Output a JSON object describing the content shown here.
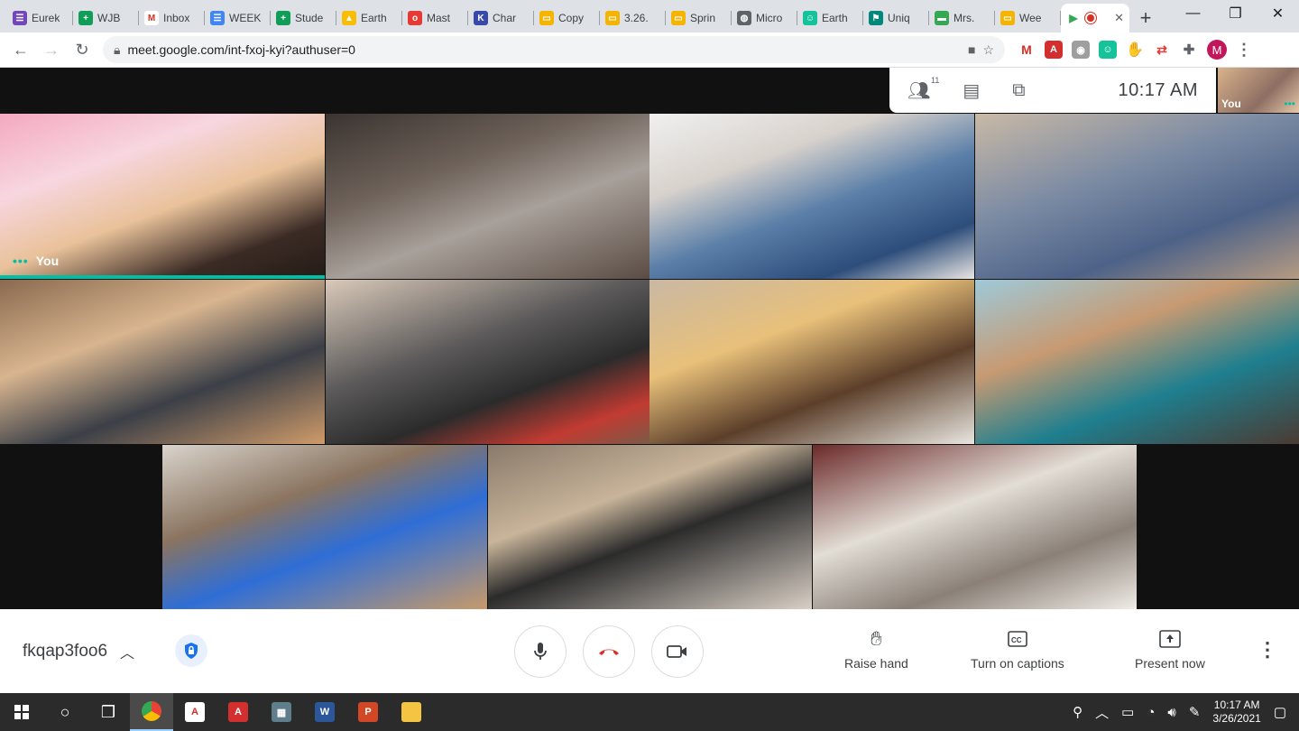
{
  "browser": {
    "tabs": [
      {
        "title": "Eurek",
        "icon": "forms-icon",
        "color": "#7248b9",
        "glyph": "☰"
      },
      {
        "title": "WJB",
        "icon": "sheets-icon",
        "color": "#0f9d58",
        "glyph": "+"
      },
      {
        "title": "Inbox",
        "icon": "gmail-icon",
        "color": "#ffffff",
        "glyph": "M"
      },
      {
        "title": "WEEK",
        "icon": "docs-icon",
        "color": "#4285f4",
        "glyph": "☰"
      },
      {
        "title": "Stude",
        "icon": "sheets-icon",
        "color": "#0f9d58",
        "glyph": "+"
      },
      {
        "title": "Earth",
        "icon": "drive-icon",
        "color": "#fbbc04",
        "glyph": "▲"
      },
      {
        "title": "Mast",
        "icon": "mastery-icon",
        "color": "#e53935",
        "glyph": "o"
      },
      {
        "title": "Char",
        "icon": "k-icon",
        "color": "#3949ab",
        "glyph": "K"
      },
      {
        "title": "Copy",
        "icon": "slides-icon",
        "color": "#f4b400",
        "glyph": "▭"
      },
      {
        "title": "3.26.",
        "icon": "slides-icon",
        "color": "#f4b400",
        "glyph": "▭"
      },
      {
        "title": "Sprin",
        "icon": "slides-icon",
        "color": "#f4b400",
        "glyph": "▭"
      },
      {
        "title": "Micro",
        "icon": "globe-icon",
        "color": "#5f6368",
        "glyph": "◍"
      },
      {
        "title": "Earth",
        "icon": "grammarly-icon",
        "color": "#15c39a",
        "glyph": "☺"
      },
      {
        "title": "Uniq",
        "icon": "flag-icon",
        "color": "#00897b",
        "glyph": "⚑"
      },
      {
        "title": "Mrs.",
        "icon": "meet-icon",
        "color": "#34a853",
        "glyph": "▬"
      },
      {
        "title": "Wee",
        "icon": "slides-icon",
        "color": "#f4b400",
        "glyph": "▭"
      }
    ],
    "active_tab": {
      "title": "",
      "icon": "meet-recording-icon"
    },
    "url": "meet.google.com/int-fxoj-kyi?authuser=0",
    "profile_initial": "M"
  },
  "meet": {
    "participants_count": "11",
    "clock": "10:17  AM",
    "self_label": "You",
    "tiles": [
      {
        "label": "You",
        "bg": "linear-gradient(160deg,#f4a9c0 0%,#f7d6e0 30%,#e9c29a 55%,#3b2b25 80%,#241a16 100%)"
      },
      {
        "label": "",
        "bg": "linear-gradient(160deg,#3b3431 0%,#6e625a 35%,#a8a09a 60%,#5a4c44 100%)"
      },
      {
        "label": "",
        "bg": "linear-gradient(160deg,#f0f0f0 0%,#d8d2cc 30%,#5b7fa8 55%,#2d4d7a 80%,#e9e6e2 100%)"
      },
      {
        "label": "",
        "bg": "linear-gradient(160deg,#c9b9a6 0%,#7a8aa3 40%,#4d6288 70%,#b59b82 100%)"
      },
      {
        "label": "",
        "bg": "linear-gradient(160deg,#8a6a4f 0%,#d8b58f 35%,#3b3f47 65%,#cf9b6a 100%)"
      },
      {
        "label": "",
        "bg": "linear-gradient(160deg,#d9c9b9 0%,#5c5a5a 40%,#2b2b2b 65%,#c23b32 85%,#7a5a47 100%)"
      },
      {
        "label": "",
        "bg": "linear-gradient(160deg,#c9b8a3 0%,#e8c07a 35%,#5c3f2a 65%,#e8e6e0 100%)"
      },
      {
        "label": "",
        "bg": "linear-gradient(160deg,#9ec9d9 0%,#c79a72 35%,#1e7f8f 65%,#4b3a32 100%)"
      },
      {
        "label": "",
        "bg": "linear-gradient(160deg,#d9d4cc 0%,#8a7460 35%,#2f6ed6 60%,#c79a6a 100%)"
      },
      {
        "label": "",
        "bg": "linear-gradient(160deg,#8a7a6a 0%,#c8b49a 35%,#2b2b2b 55%,#d9cfc5 100%)"
      },
      {
        "label": "",
        "bg": "linear-gradient(160deg,#6b2a2a 0%,#e2ddd5 40%,#8a8078 70%,#f0ece6 100%)"
      }
    ]
  },
  "controls": {
    "meeting_code": "fkqap3foo6",
    "raise_hand": "Raise hand",
    "captions": "Turn on captions",
    "present": "Present now"
  },
  "taskbar": {
    "time": "10:17 AM",
    "date": "3/26/2021"
  }
}
